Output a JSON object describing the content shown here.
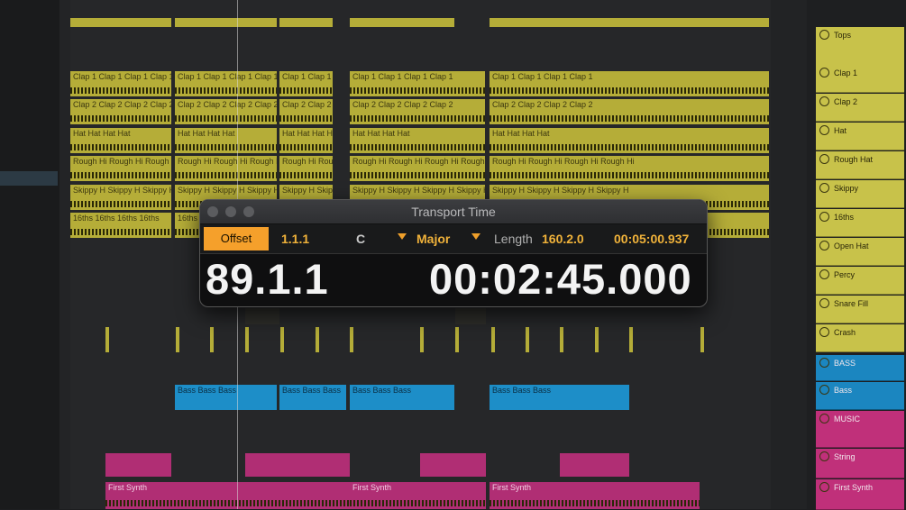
{
  "window": {
    "title": "Transport Time"
  },
  "transport": {
    "offset_label": "Offset",
    "offset_value": "1.1.1",
    "key": "C",
    "scale": "Major",
    "length_label": "Length",
    "length_value": "160.2.0",
    "length_time": "00:05:00.937",
    "position_bars": "89.1.1",
    "position_time": "00:02:45.000"
  },
  "tracks": [
    {
      "name": "Tops",
      "color": "#c8c24a"
    },
    {
      "name": "Clap 1",
      "color": "#c8c24a"
    },
    {
      "name": "Clap 2",
      "color": "#c8c24a"
    },
    {
      "name": "Hat",
      "color": "#c8c24a"
    },
    {
      "name": "Rough Hat",
      "color": "#c8c24a"
    },
    {
      "name": "Skippy",
      "color": "#c8c24a"
    },
    {
      "name": "16ths",
      "color": "#c8c24a"
    },
    {
      "name": "Open Hat",
      "color": "#c8c24a"
    },
    {
      "name": "Percy",
      "color": "#c8c24a"
    },
    {
      "name": "Snare Fill",
      "color": "#c8c24a"
    },
    {
      "name": "Crash",
      "color": "#c8c24a"
    },
    {
      "name": "BASS",
      "color": "#1b86c0"
    },
    {
      "name": "Bass",
      "color": "#1b86c0"
    },
    {
      "name": "MUSIC",
      "color": "#c0307a"
    },
    {
      "name": "String",
      "color": "#c0307a"
    },
    {
      "name": "First Synth",
      "color": "#c0307a"
    }
  ],
  "clip_lanes": [
    {
      "label": "Clap 1",
      "color": "#b5ad38"
    },
    {
      "label": "Clap 2",
      "color": "#b5ad38"
    },
    {
      "label": "Hat",
      "color": "#b5ad38"
    },
    {
      "label": "Rough Hi",
      "color": "#b5ad38"
    },
    {
      "label": "Skippy H",
      "color": "#b5ad38"
    },
    {
      "label": "16ths",
      "color": "#b5ad38"
    },
    {
      "label": "Bass",
      "color": "#1d8ec8"
    },
    {
      "label": "First Synth",
      "color": "#b02e74"
    }
  ]
}
